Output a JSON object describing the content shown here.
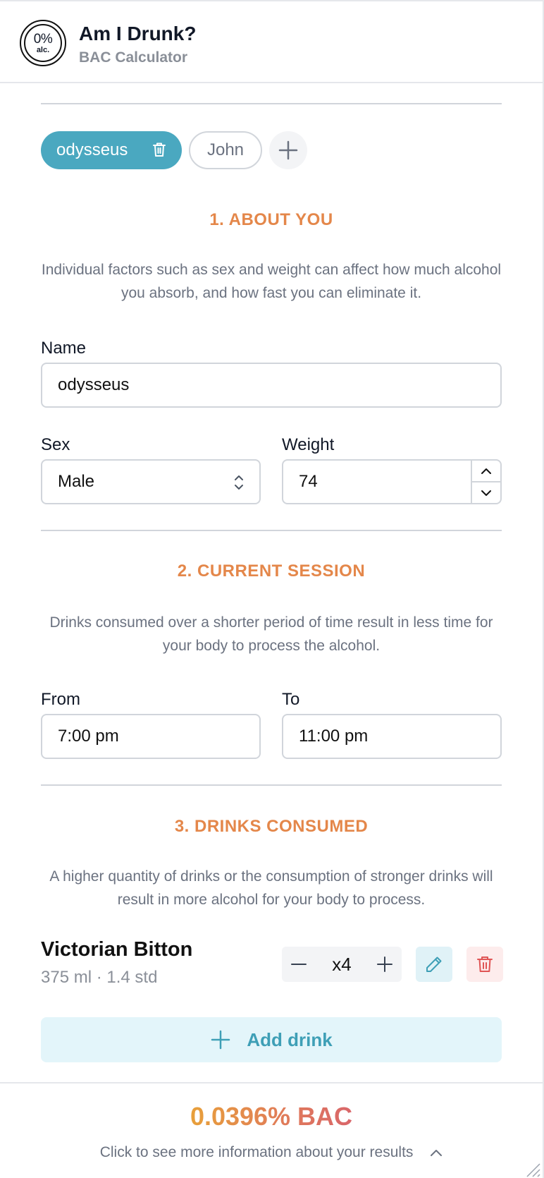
{
  "app": {
    "logo_pct": "0%",
    "logo_alc": "alc.",
    "title": "Am I Drunk?",
    "subtitle": "BAC Calculator"
  },
  "profiles": [
    {
      "name": "odysseus",
      "active": true
    },
    {
      "name": "John",
      "active": false
    }
  ],
  "about": {
    "title": "1. ABOUT YOU",
    "description": "Individual factors such as sex and weight can affect how much alcohol you absorb, and how fast you can eliminate it.",
    "name_label": "Name",
    "name_value": "odysseus",
    "sex_label": "Sex",
    "sex_value": "Male",
    "weight_label": "Weight",
    "weight_value": "74"
  },
  "session": {
    "title": "2. CURRENT SESSION",
    "description": "Drinks consumed over a shorter period of time result in less time for your body to process the alcohol.",
    "from_label": "From",
    "from_value": "7:00 pm",
    "to_label": "To",
    "to_value": "11:00 pm"
  },
  "drinks": {
    "title": "3. DRINKS CONSUMED",
    "description": "A higher quantity of drinks or the consumption of stronger drinks will result in more alcohol for your body to process.",
    "items": [
      {
        "name": "Victorian Bitton",
        "meta": "375 ml · 1.4 std",
        "quantity": "x4"
      }
    ],
    "add_label": "Add drink"
  },
  "result": {
    "bac": "0.0396% BAC",
    "hint": "Click to see more information about your results"
  },
  "colors": {
    "accent": "#4aa8c0",
    "section_title": "#e4874a",
    "danger": "#e05555"
  }
}
